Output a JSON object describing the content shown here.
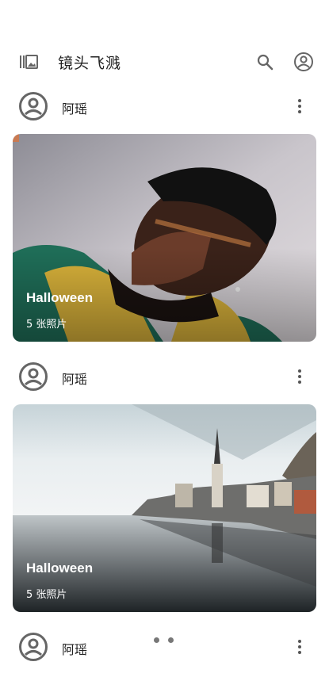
{
  "appbar": {
    "title": "镜头飞溅",
    "icons": [
      "photo-library-icon",
      "search-icon",
      "account-circle-icon"
    ]
  },
  "posts": [
    {
      "username": "阿瑶",
      "album_title": "Halloween",
      "photo_count": "5 张照片"
    },
    {
      "username": "阿瑶",
      "album_title": "Halloween",
      "photo_count": "5 张照片"
    },
    {
      "username": "阿瑶"
    }
  ],
  "pager": {
    "dots": 2
  },
  "colors": {
    "icon": "#666666",
    "text": "#222222",
    "background": "#ffffff"
  }
}
